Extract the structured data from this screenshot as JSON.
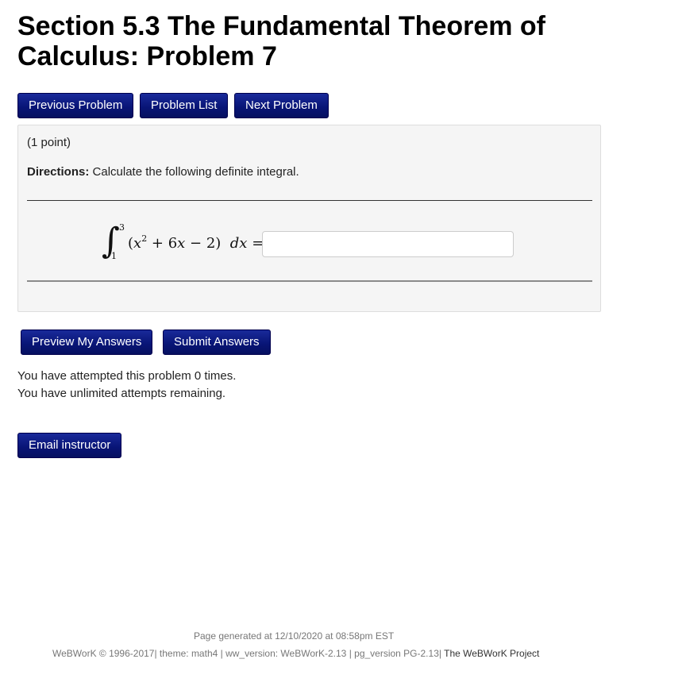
{
  "header": {
    "title": "Section 5.3 The Fundamental Theorem of Calculus: Problem 7"
  },
  "nav": {
    "previous_label": "Previous Problem",
    "list_label": "Problem List",
    "next_label": "Next Problem"
  },
  "problem": {
    "points": "(1 point)",
    "directions_label": "Directions:",
    "directions_text": " Calculate the following definite integral.",
    "integral": {
      "lower": "1",
      "upper": "3",
      "integrand_open": "(",
      "integrand_x": "x",
      "integrand_exp": "2",
      "integrand_rest": " + 6",
      "integrand_x2": "x",
      "integrand_end": " − 2)",
      "differential": "dx",
      "equals": "="
    },
    "answer_value": ""
  },
  "actions": {
    "preview_label": "Preview My Answers",
    "submit_label": "Submit Answers"
  },
  "status": {
    "attempted": "You have attempted this problem 0 times.",
    "remaining": "You have unlimited attempts remaining."
  },
  "email": {
    "label": "Email instructor"
  },
  "footer": {
    "generated": "Page generated at 12/10/2020 at 08:58pm EST",
    "version_text": "WeBWorK © 1996-2017| theme: math4 | ww_version: WeBWorK-2.13 | pg_version PG-2.13| ",
    "project_link": "The WeBWorK Project"
  },
  "colors": {
    "button_bg": "#081475",
    "panel_bg": "#f5f5f5"
  }
}
